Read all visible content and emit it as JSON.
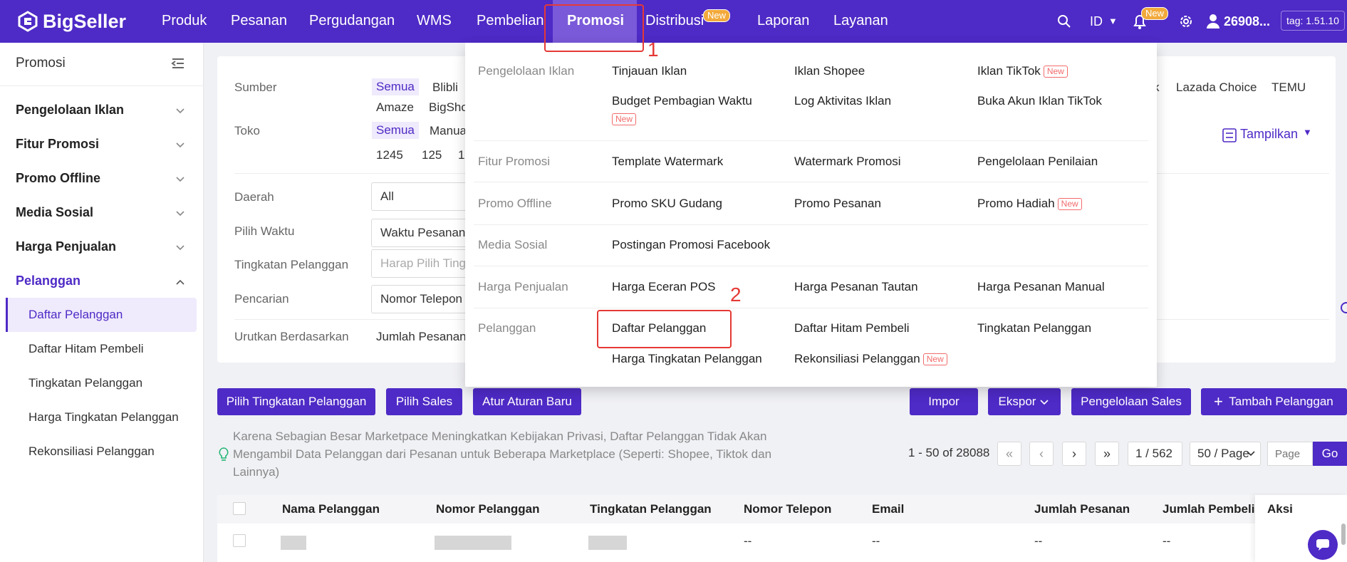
{
  "brand": {
    "name": "BigSeller",
    "color": "#4e2ac6"
  },
  "topnav": {
    "items": [
      "Produk",
      "Pesanan",
      "Pergudangan",
      "WMS",
      "Pembelian",
      "Promosi",
      "Distribusi",
      "Laporan",
      "Layanan"
    ],
    "active": "Promosi",
    "new_badge": "New",
    "lang": "ID",
    "user": "26908...",
    "version": "tag: 1.51.10"
  },
  "sidebar": {
    "title": "Promosi",
    "groups": [
      "Pengelolaan Iklan",
      "Fitur Promosi",
      "Promo Offline",
      "Media Sosial",
      "Harga Penjualan",
      "Pelanggan"
    ],
    "sub_items": [
      "Daftar Pelanggan",
      "Daftar Hitam Pembeli",
      "Tingkatan Pelanggan",
      "Harga Tingkatan Pelanggan",
      "Rekonsiliasi Pelanggan"
    ]
  },
  "filters": {
    "sumber_label": "Sumber",
    "sumber_values": [
      "Semua",
      "Blibli",
      "Amaze",
      "BigSho"
    ],
    "sumber_right": [
      "k",
      "Lazada Choice",
      "TEMU"
    ],
    "toko_label": "Toko",
    "toko_values": [
      "Semua",
      "Manua",
      "1245",
      "125",
      "1"
    ],
    "tampilkan": "Tampilkan",
    "daerah_label": "Daerah",
    "daerah_value": "All",
    "waktu_label": "Pilih Waktu",
    "waktu_value": "Waktu Pesanan",
    "tingkatan_label": "Tingkatan Pelanggan",
    "tingkatan_placeholder": "Harap Pilih Ting",
    "pencarian_label": "Pencarian",
    "pencarian_value": "Nomor Telepon",
    "urut_label": "Urutkan Berdasarkan",
    "urut_value": "Jumlah Pesanan"
  },
  "dropdown": {
    "new_label": "New",
    "cat1": "Pengelolaan Iklan",
    "cat1_items": [
      "Tinjauan Iklan",
      "Iklan Shopee",
      "Iklan TikTok",
      "Budget Pembagian Waktu",
      "Log Aktivitas Iklan",
      "Buka Akun Iklan TikTok"
    ],
    "cat2": "Fitur Promosi",
    "cat2_items": [
      "Template Watermark",
      "Watermark Promosi",
      "Pengelolaan Penilaian"
    ],
    "cat3": "Promo Offline",
    "cat3_items": [
      "Promo SKU Gudang",
      "Promo Pesanan",
      "Promo Hadiah"
    ],
    "cat4": "Media Sosial",
    "cat4_items": [
      "Postingan Promosi Facebook"
    ],
    "cat5": "Harga Penjualan",
    "cat5_items": [
      "Harga Eceran POS",
      "Harga Pesanan Tautan",
      "Harga Pesanan Manual"
    ],
    "cat6": "Pelanggan",
    "cat6_items": [
      "Daftar Pelanggan",
      "Daftar Hitam Pembeli",
      "Tingkatan Pelanggan",
      "Harga Tingkatan Pelanggan",
      "Rekonsiliasi Pelanggan"
    ]
  },
  "annotations": {
    "step1": "1",
    "step2": "2"
  },
  "actions": {
    "left": [
      "Pilih Tingkatan Pelanggan",
      "Pilih Sales",
      "Atur Aturan Baru"
    ],
    "right": [
      "Impor",
      "Ekspor",
      "Pengelolaan Sales",
      "Tambah Pelanggan"
    ]
  },
  "notice": "Karena Sebagian Besar Marketpace Meningkatkan Kebijakan Privasi, Daftar Pelanggan Tidak Akan Mengambil Data Pelanggan dari Pesanan untuk Beberapa Marketplace (Seperti: Shopee, Tiktok dan Lainnya)",
  "pagination": {
    "summary": "1 - 50 of 28088",
    "page_input": "1 / 562",
    "page_size": "50 / Page",
    "page_placeholder": "Page",
    "go": "Go"
  },
  "table": {
    "headers": [
      "Nama Pelanggan",
      "Nomor Pelanggan",
      "Tingkatan Pelanggan",
      "Nomor Telepon",
      "Email",
      "Jumlah Pesanan",
      "Jumlah Pembelia",
      "Aksi"
    ],
    "row1": [
      "--",
      "--",
      "--",
      "--"
    ]
  }
}
